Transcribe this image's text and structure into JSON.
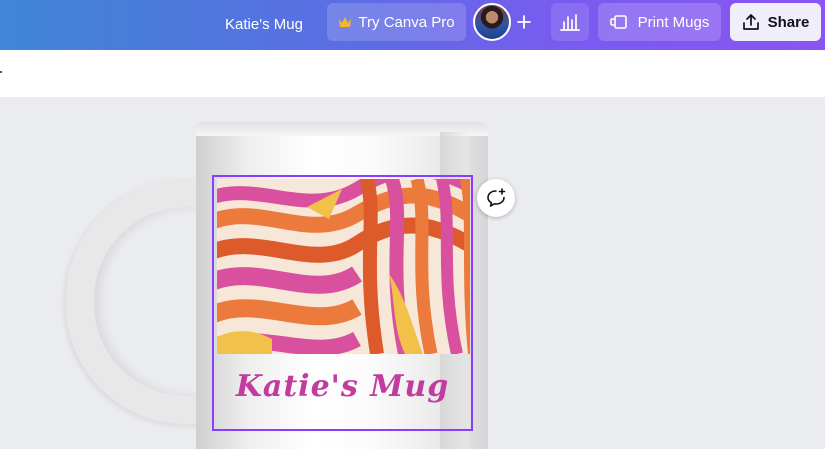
{
  "header": {
    "doc_title": "Katie's Mug",
    "pro_label": "Try Canva Pro",
    "print_label": "Print Mugs",
    "share_label": "Share",
    "icons": {
      "crown": "crown-icon",
      "add": "plus-icon",
      "stats": "bar-chart-icon",
      "print": "mug-icon",
      "share": "upload-icon"
    }
  },
  "design": {
    "mug_text": "Katie's Mug",
    "colors": {
      "selection": "#8b3dff",
      "text": "#c23b9f",
      "pink": "#d9509e",
      "orange": "#ec7a3c",
      "deep_orange": "#dd5a2a",
      "yellow": "#f2c14a",
      "cream": "#f6e7d8"
    }
  },
  "colors": {
    "topbar_start": "#3f86d6",
    "topbar_end": "#8a55f2",
    "canvas_bg": "#ebecf0"
  }
}
